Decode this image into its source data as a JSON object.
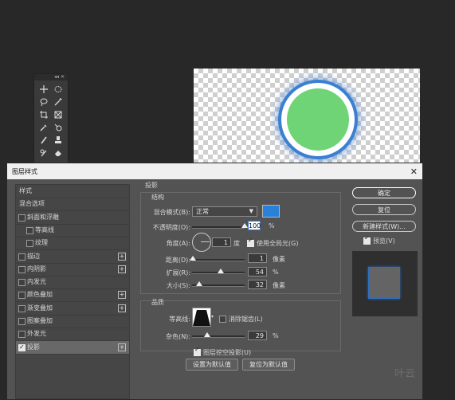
{
  "dialog": {
    "title": "图层样式",
    "close_label": "✕"
  },
  "style_list": [
    {
      "label": "样式",
      "checkbox": false,
      "plus": false,
      "indent": "none"
    },
    {
      "label": "混合选项",
      "checkbox": false,
      "plus": false,
      "indent": "none"
    },
    {
      "label": "斜面和浮雕",
      "checkbox": true,
      "checked": false,
      "plus": false
    },
    {
      "label": "等高线",
      "checkbox": true,
      "checked": false,
      "plus": false,
      "indent": "sub"
    },
    {
      "label": "纹理",
      "checkbox": true,
      "checked": false,
      "plus": false,
      "indent": "sub"
    },
    {
      "label": "描边",
      "checkbox": true,
      "checked": false,
      "plus": true
    },
    {
      "label": "内阴影",
      "checkbox": true,
      "checked": false,
      "plus": true
    },
    {
      "label": "内发光",
      "checkbox": true,
      "checked": false,
      "plus": false
    },
    {
      "label": "颜色叠加",
      "checkbox": true,
      "checked": false,
      "plus": true
    },
    {
      "label": "渐变叠加",
      "checkbox": true,
      "checked": false,
      "plus": true
    },
    {
      "label": "图案叠加",
      "checkbox": true,
      "checked": false,
      "plus": false
    },
    {
      "label": "外发光",
      "checkbox": true,
      "checked": false,
      "plus": false
    },
    {
      "label": "投影",
      "checkbox": true,
      "checked": true,
      "plus": true,
      "selected": true
    }
  ],
  "shadow": {
    "section_title": "投影",
    "structure_title": "结构",
    "blend_mode_label": "混合模式(B):",
    "blend_mode_value": "正常",
    "shadow_color": "#2b80d8",
    "opacity_label": "不透明度(O):",
    "opacity_value": "100",
    "opacity_fraction": 1.0,
    "percent": "%",
    "angle_label": "角度(A):",
    "angle_value": "1",
    "angle_unit": "度",
    "global_light_label": "使用全局光(G)",
    "global_light_checked": true,
    "distance_label": "距离(D):",
    "distance_value": "1",
    "distance_fraction": 0.01,
    "pixel_unit": "像素",
    "spread_label": "扩展(R):",
    "spread_value": "54",
    "spread_fraction": 0.54,
    "size_label": "大小(S):",
    "size_value": "32",
    "size_fraction": 0.13,
    "quality_title": "品质",
    "contour_label": "等高线:",
    "antialias_label": "消除锯齿(L)",
    "antialias_checked": false,
    "noise_label": "杂色(N):",
    "noise_value": "29",
    "noise_fraction": 0.29,
    "knockout_label": "图层挖空投影(U)",
    "knockout_checked": true,
    "make_default_label": "设置为默认值",
    "reset_default_label": "复位为默认值"
  },
  "buttons": {
    "ok": "确定",
    "reset": "复位",
    "new_style": "新建样式(W)...",
    "preview_label": "预览(V)",
    "preview_checked": true
  },
  "toolbar": {
    "collapse": "◂◂ ✕"
  },
  "watermark": "叶云"
}
